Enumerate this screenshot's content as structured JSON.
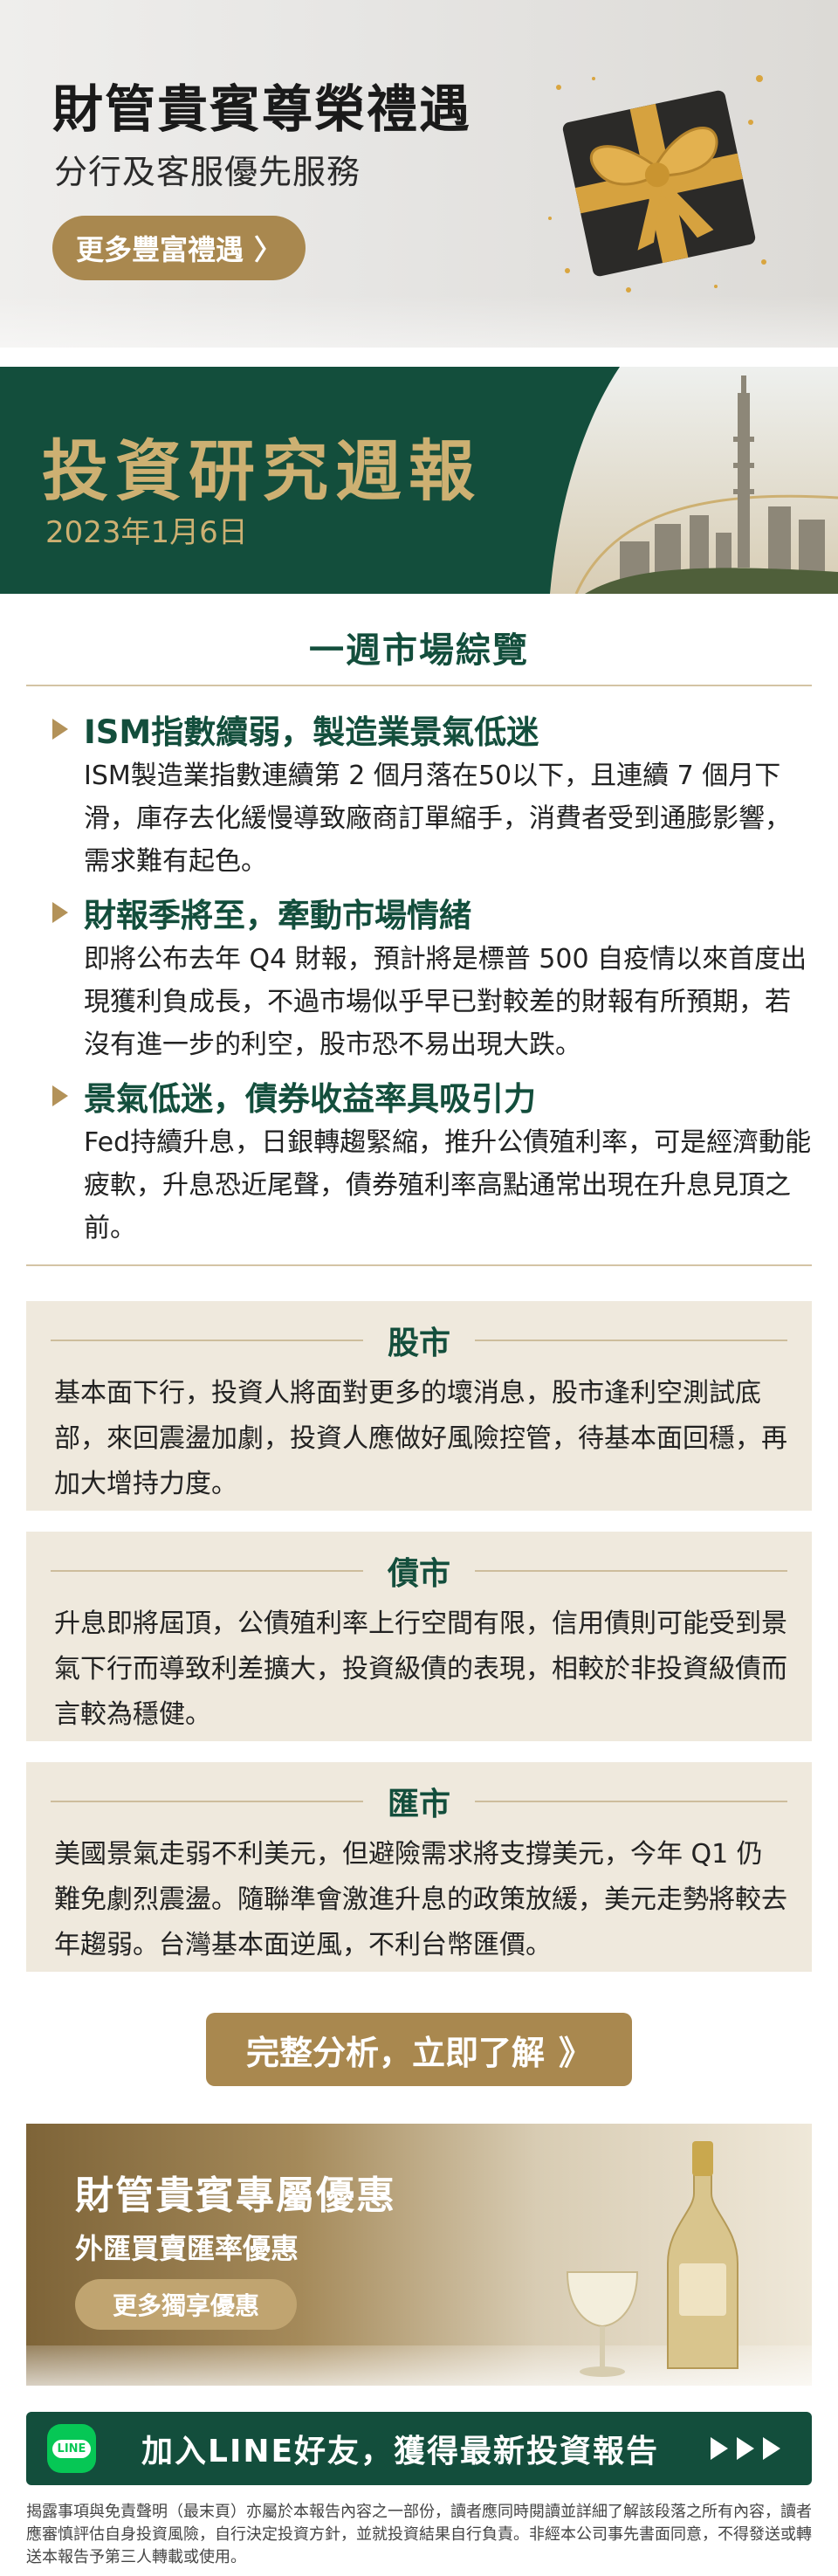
{
  "top_banner": {
    "title": "財管貴賓尊榮禮遇",
    "subtitle": "分行及客服優先服務",
    "button_label": "更多豐富禮遇",
    "button_arrow": "〉",
    "gift_icon": "gift-box-with-gold-ribbon"
  },
  "report_header": {
    "title": "投資研究週報",
    "date": "2023年1月6日",
    "image": "taipei-101-skyline"
  },
  "overview": {
    "heading": "一週市場綜覽",
    "points": [
      {
        "title": "ISM指數續弱，製造業景氣低迷",
        "body": " ISM製造業指數連續第 2 個月落在50以下，且連續 7 個月下滑，庫存去化緩慢導致廠商訂單縮手，消費者受到通膨影響，需求難有起色。"
      },
      {
        "title": "財報季將至，牽動市場情緒",
        "body": "即將公布去年 Q4 財報，預計將是標普 500 自疫情以來首度出現獲利負成長，不過市場似乎早已對較差的財報有所預期，若沒有進一步的利空，股市恐不易出現大跌。"
      },
      {
        "title": "景氣低迷，債券收益率具吸引力",
        "body": " Fed持續升息，日銀轉趨緊縮，推升公債殖利率，可是經濟動能疲軟，升息恐近尾聲，債券殖利率高點通常出現在升息見頂之前。"
      }
    ]
  },
  "sections": {
    "stocks": {
      "title": "股市",
      "body": "基本面下行，投資人將面對更多的壞消息，股市逢利空測試底部，來回震盪加劇，投資人應做好風險控管，待基本面回穩，再加大增持力度。"
    },
    "bonds": {
      "title": "債市",
      "body": "升息即將屆頂，公債殖利率上行空間有限，信用債則可能受到景氣下行而導致利差擴大，投資級債的表現，相較於非投資級債而言較為穩健。"
    },
    "fx": {
      "title": "匯市",
      "body": "美國景氣走弱不利美元，但避險需求將支撐美元，今年 Q1 仍難免劇烈震盪。隨聯準會激進升息的政策放緩，美元走勢將較去年趨弱。台灣基本面逆風，不利台幣匯價。"
    }
  },
  "cta": {
    "label": "完整分析，立即了解",
    "arrow": "》"
  },
  "promo": {
    "title": "財管貴賓專屬優惠",
    "subtitle": "外匯買賣匯率優惠",
    "button_label": "更多獨享優惠",
    "image": "champagne-bottle-and-glass"
  },
  "line_bar": {
    "icon_text": "LINE",
    "label": "加入LINE好友，獲得最新投資報告"
  },
  "disclaimer": "揭露事項與免責聲明（最末頁）亦屬於本報告內容之一部份，讀者應同時閱讀並詳細了解該段落之所有內容，讀者應審慎評估自身投資風險，自行決定投資方針，並就投資結果自行負責。非經本公司事先書面同意，不得發送或轉送本報告予第三人轉載或使用。",
  "colors": {
    "brand_green": "#134e3c",
    "gold": "#a9884f",
    "light_gold": "#cdb072",
    "section_bg": "#efe9dd",
    "line_green": "#06c755"
  }
}
